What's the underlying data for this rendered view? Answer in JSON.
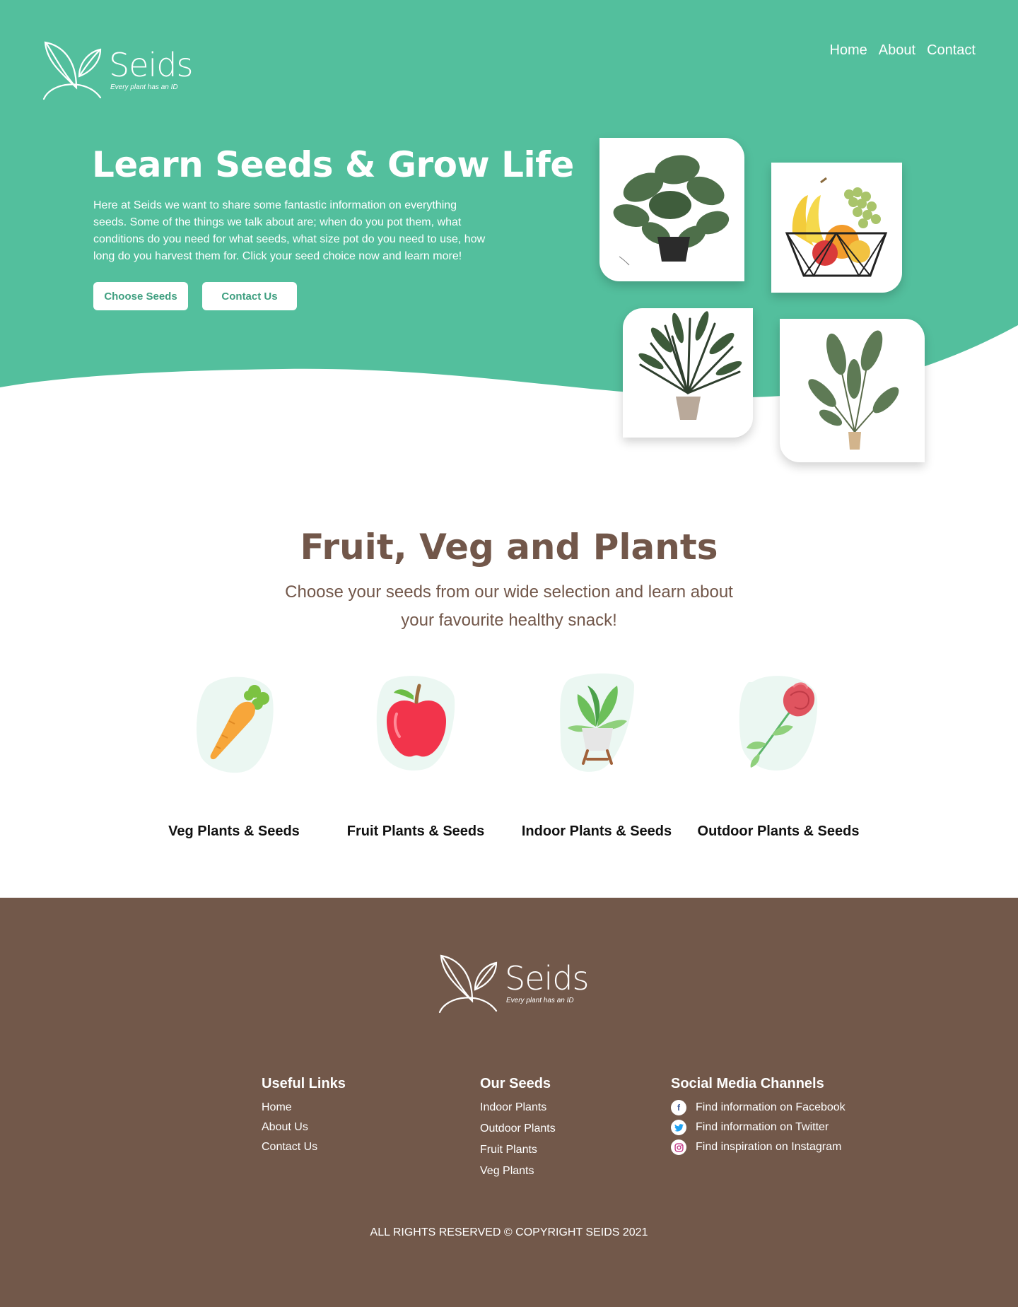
{
  "colors": {
    "primary": "#53bf9d",
    "brown": "#72584a",
    "button_text": "#3f9f80"
  },
  "brand": {
    "name": "Seids",
    "tagline": "Every plant has an ID"
  },
  "nav": [
    "Home",
    "About",
    "Contact"
  ],
  "hero": {
    "title": "Learn Seeds & Grow Life",
    "description": "Here at Seids we want to share some fantastic information on everything seeds. Some of the things we talk about are; when do you pot them, what conditions do you need for what seeds, what size pot do you need to use, how long do you harvest them for. Click your seed choice now and learn more!",
    "buttons": {
      "choose": "Choose Seeds",
      "contact": "Contact Us"
    },
    "images": [
      "monstera-plant",
      "fruit-basket",
      "palm-plant",
      "banana-plant"
    ]
  },
  "section": {
    "title": "Fruit, Veg and Plants",
    "subtitle": "Choose your seeds from our wide selection and learn about your favourite healthy snack!",
    "categories": [
      {
        "label": "Veg Plants & Seeds",
        "icon": "carrot-icon"
      },
      {
        "label": "Fruit Plants & Seeds",
        "icon": "apple-icon"
      },
      {
        "label": "Indoor Plants & Seeds",
        "icon": "potted-plant-icon"
      },
      {
        "label": "Outdoor Plants & Seeds",
        "icon": "rose-icon"
      }
    ]
  },
  "footer": {
    "useful_links": {
      "title": "Useful Links",
      "items": [
        "Home",
        "About Us",
        "Contact Us"
      ]
    },
    "our_seeds": {
      "title": "Our Seeds",
      "items": [
        "Indoor Plants",
        "Outdoor Plants",
        "Fruit Plants",
        "Veg Plants"
      ]
    },
    "social": {
      "title": "Social Media Channels",
      "items": [
        {
          "text": "Find information on Facebook",
          "icon": "facebook-icon"
        },
        {
          "text": "Find information on Twitter",
          "icon": "twitter-icon"
        },
        {
          "text": "Find inspiration on Instagram",
          "icon": "instagram-icon"
        }
      ]
    },
    "copyright": "ALL RIGHTS RESERVED © COPYRIGHT SEIDS 2021"
  }
}
